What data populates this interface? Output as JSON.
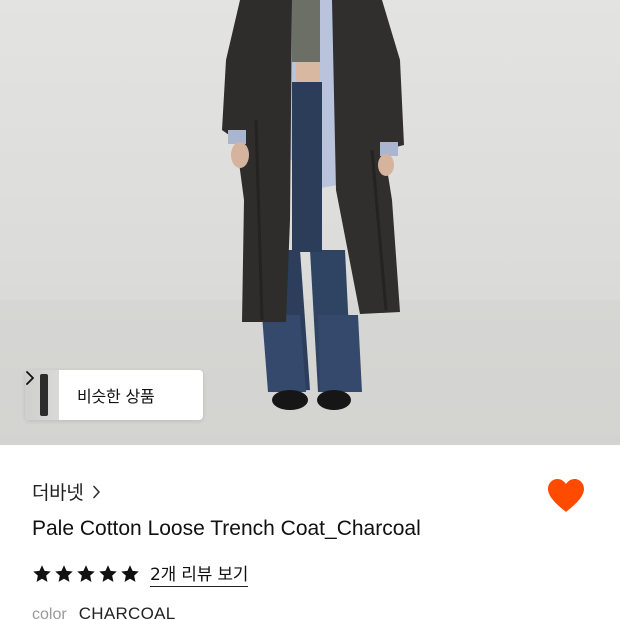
{
  "photo": {
    "alt_subject": "model-wearing-coat",
    "background_color": "#dcdcda"
  },
  "similar": {
    "label": "비슷한 상품",
    "chevron_icon": "chevron-right-icon"
  },
  "brand": {
    "name": "더바넷",
    "chevron_icon": "chevron-right-icon"
  },
  "wishlist": {
    "icon": "heart-icon",
    "active": true,
    "color": "#ff4b00"
  },
  "product": {
    "title": "Pale Cotton Loose Trench Coat_Charcoal"
  },
  "rating": {
    "stars": 5,
    "star_icon": "star-icon",
    "review_link": "2개 리뷰 보기"
  },
  "option": {
    "label": "color",
    "value": "CHARCOAL"
  }
}
